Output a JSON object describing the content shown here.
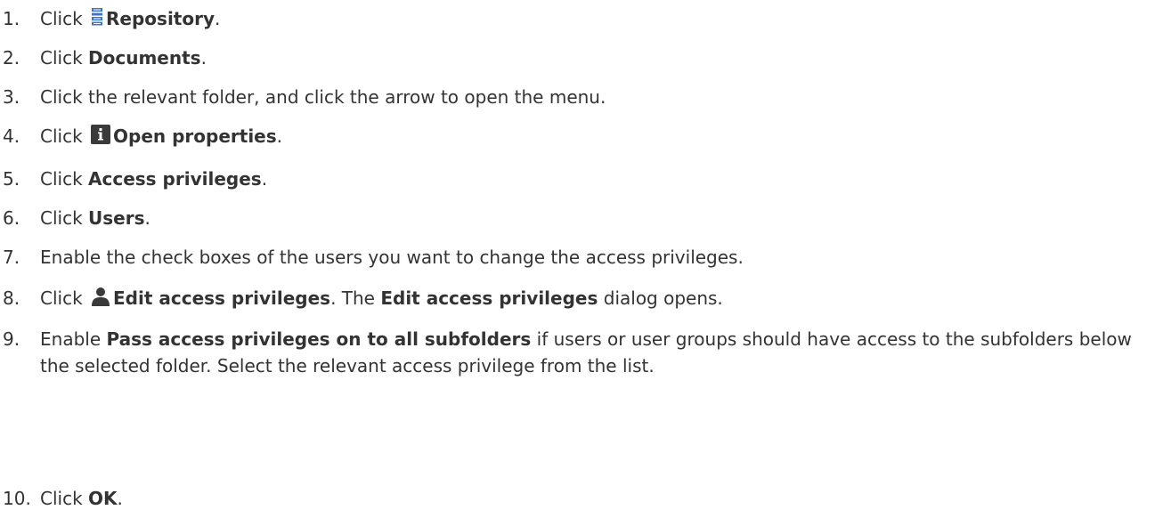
{
  "steps": [
    {
      "number": "1.",
      "pre": "Click ",
      "icon": "repository-icon",
      "bold": "Repository",
      "post": "."
    },
    {
      "number": "2.",
      "pre": "Click ",
      "bold": "Documents",
      "post": "."
    },
    {
      "number": "3.",
      "text": "Click the relevant folder, and click the arrow to open the menu."
    },
    {
      "number": "4.",
      "pre": "Click ",
      "icon": "info-icon",
      "bold": "Open properties",
      "post": "."
    },
    {
      "number": "5.",
      "pre": "Click ",
      "bold": "Access privileges",
      "post": "."
    },
    {
      "number": "6.",
      "pre": "Click ",
      "bold": "Users",
      "post": "."
    },
    {
      "number": "7.",
      "text": "Enable the check boxes of the users you want to change the access privileges."
    },
    {
      "number": "8.",
      "pre": "Click ",
      "icon": "user-icon",
      "bold": "Edit access privileges",
      "mid": ". The ",
      "bold2": "Edit access privileges",
      "post": " dialog opens."
    },
    {
      "number": "9.",
      "pre": "Enable ",
      "bold": "Pass access privileges on to all subfolders",
      "post": " if users or user groups should have access to the subfolders below the selected folder. Select the relevant access privilege from the list."
    },
    {
      "number": "10.",
      "pre": "Click ",
      "bold": "OK",
      "post": "."
    }
  ],
  "colors": {
    "text": "#333333",
    "repository_icon": "#3d78c8",
    "info_icon_bg": "#3a3a3a",
    "user_icon": "#3a3a3a"
  }
}
